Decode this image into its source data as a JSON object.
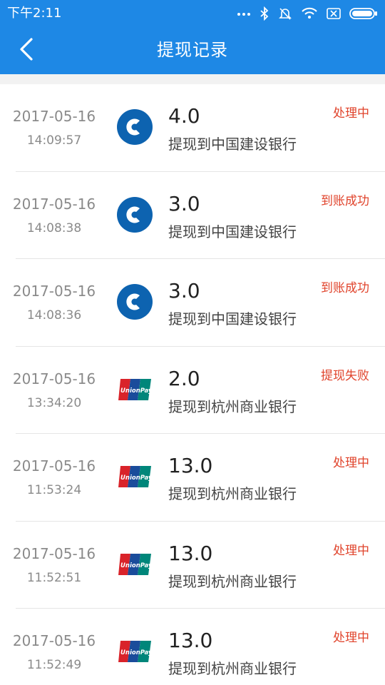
{
  "status_bar": {
    "time": "下午2:11"
  },
  "header": {
    "title": "提现记录"
  },
  "records": [
    {
      "date": "2017-05-16",
      "time": "14:09:57",
      "amount": "4.0",
      "description": "提现到中国建设银行",
      "status": "处理中",
      "bank_icon": "ccb-logo-icon"
    },
    {
      "date": "2017-05-16",
      "time": "14:08:38",
      "amount": "3.0",
      "description": "提现到中国建设银行",
      "status": "到账成功",
      "bank_icon": "ccb-logo-icon"
    },
    {
      "date": "2017-05-16",
      "time": "14:08:36",
      "amount": "3.0",
      "description": "提现到中国建设银行",
      "status": "到账成功",
      "bank_icon": "ccb-logo-icon"
    },
    {
      "date": "2017-05-16",
      "time": "13:34:20",
      "amount": "2.0",
      "description": "提现到杭州商业银行",
      "status": "提现失败",
      "bank_icon": "unionpay-logo-icon"
    },
    {
      "date": "2017-05-16",
      "time": "11:53:24",
      "amount": "13.0",
      "description": "提现到杭州商业银行",
      "status": "处理中",
      "bank_icon": "unionpay-logo-icon"
    },
    {
      "date": "2017-05-16",
      "time": "11:52:51",
      "amount": "13.0",
      "description": "提现到杭州商业银行",
      "status": "处理中",
      "bank_icon": "unionpay-logo-icon"
    },
    {
      "date": "2017-05-16",
      "time": "11:52:49",
      "amount": "13.0",
      "description": "提现到杭州商业银行",
      "status": "处理中",
      "bank_icon": "unionpay-logo-icon"
    }
  ],
  "colors": {
    "app_bar": "#1E88E5",
    "status_text": "#E0432B",
    "ccb_blue": "#0D63B0"
  }
}
